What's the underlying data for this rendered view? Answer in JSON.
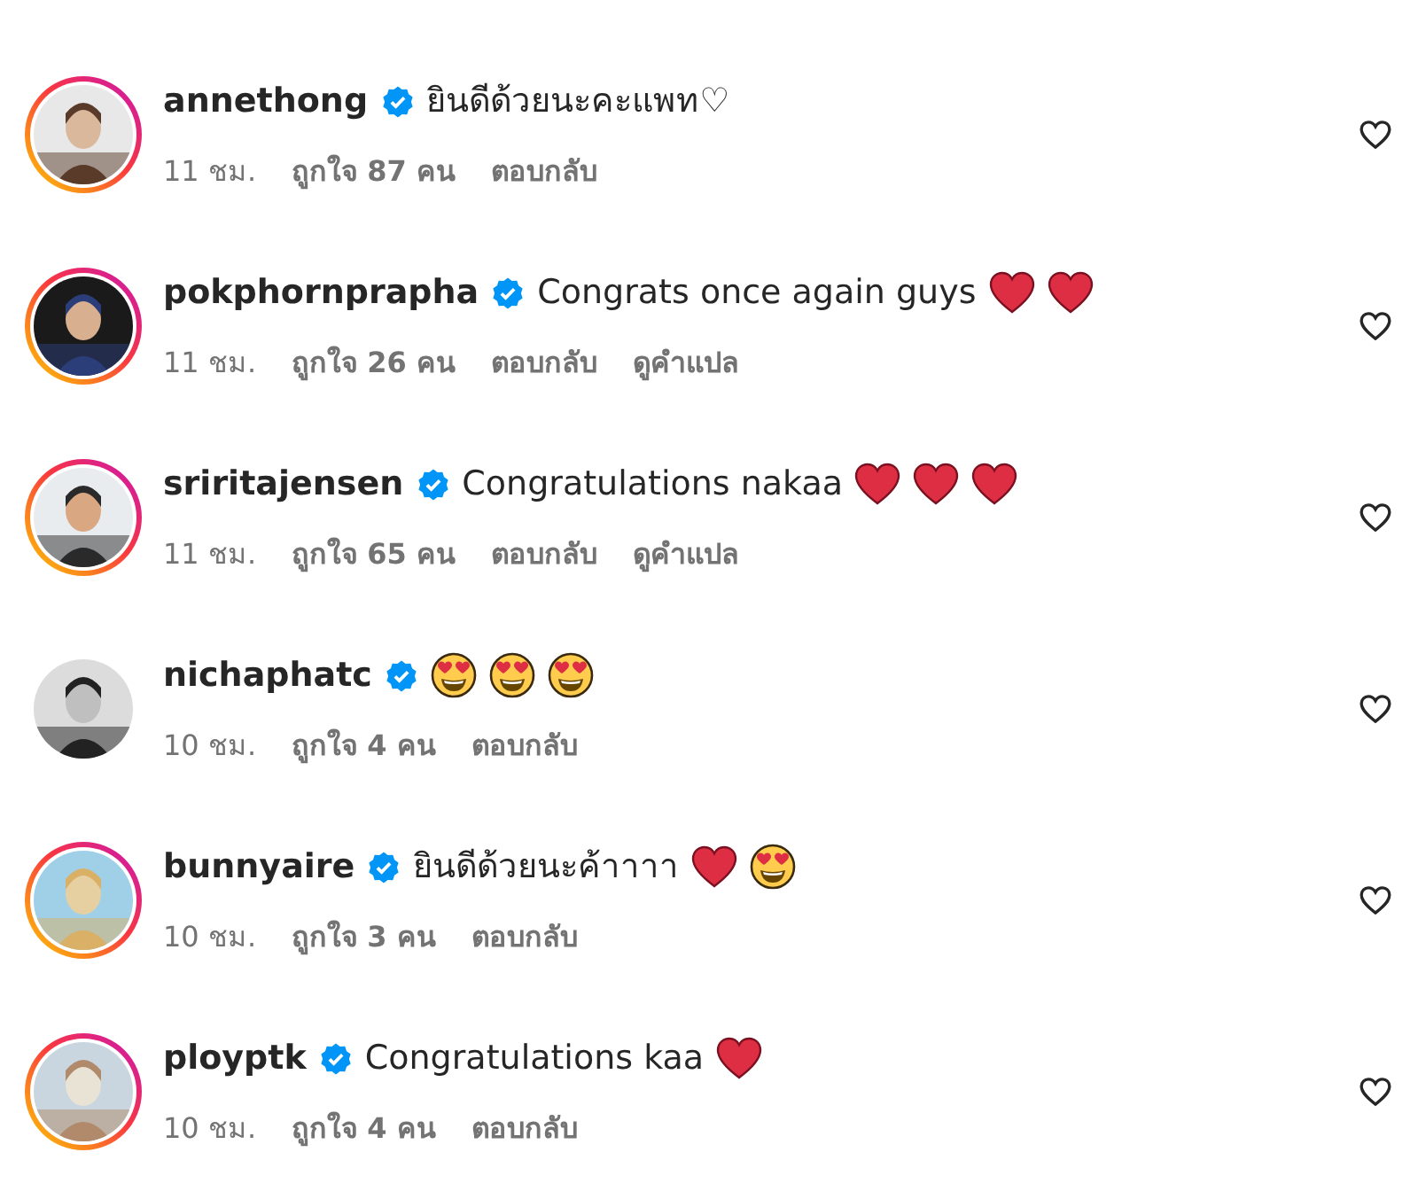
{
  "comments": [
    {
      "username": "annethong",
      "verified": true,
      "story_ring": true,
      "text": "ยินดีด้วยนะคะแพท♡",
      "time": "11 ชม.",
      "likes": "ถูกใจ 87 คน",
      "reply": "ตอบกลับ"
    },
    {
      "username": "pokphornprapha",
      "verified": true,
      "story_ring": true,
      "text": "Congrats once again guys",
      "emojis": [
        {
          "kind": "heart"
        },
        {
          "kind": "heart"
        }
      ],
      "time": "11 ชม.",
      "likes": "ถูกใจ 26 คน",
      "reply": "ตอบกลับ",
      "translate": "ดูคำแปล"
    },
    {
      "username": "sriritajensen",
      "verified": true,
      "story_ring": true,
      "text": "Congratulations nakaa",
      "emojis": [
        {
          "kind": "heart"
        },
        {
          "kind": "heart"
        },
        {
          "kind": "heart"
        }
      ],
      "time": "11 ชม.",
      "likes": "ถูกใจ 65 คน",
      "reply": "ตอบกลับ",
      "translate": "ดูคำแปล"
    },
    {
      "username": "nichaphatc",
      "verified": true,
      "story_ring": false,
      "emojis": [
        {
          "kind": "heart-eyes"
        },
        {
          "kind": "heart-eyes"
        },
        {
          "kind": "heart-eyes"
        }
      ],
      "time": "10 ชม.",
      "likes": "ถูกใจ 4 คน",
      "reply": "ตอบกลับ"
    },
    {
      "username": "bunnyaire",
      "verified": true,
      "story_ring": true,
      "text": "ยินดีด้วยนะค้าาาา",
      "emojis": [
        {
          "kind": "heart"
        },
        {
          "kind": "heart-eyes"
        }
      ],
      "time": "10 ชม.",
      "likes": "ถูกใจ 3 คน",
      "reply": "ตอบกลับ"
    },
    {
      "username": "ployptk",
      "verified": true,
      "story_ring": true,
      "text": "Congratulations kaa",
      "emojis": [
        {
          "kind": "heart"
        }
      ],
      "time": "10 ชม.",
      "likes": "ถูกใจ 4 คน",
      "reply": "ตอบกลับ"
    }
  ]
}
